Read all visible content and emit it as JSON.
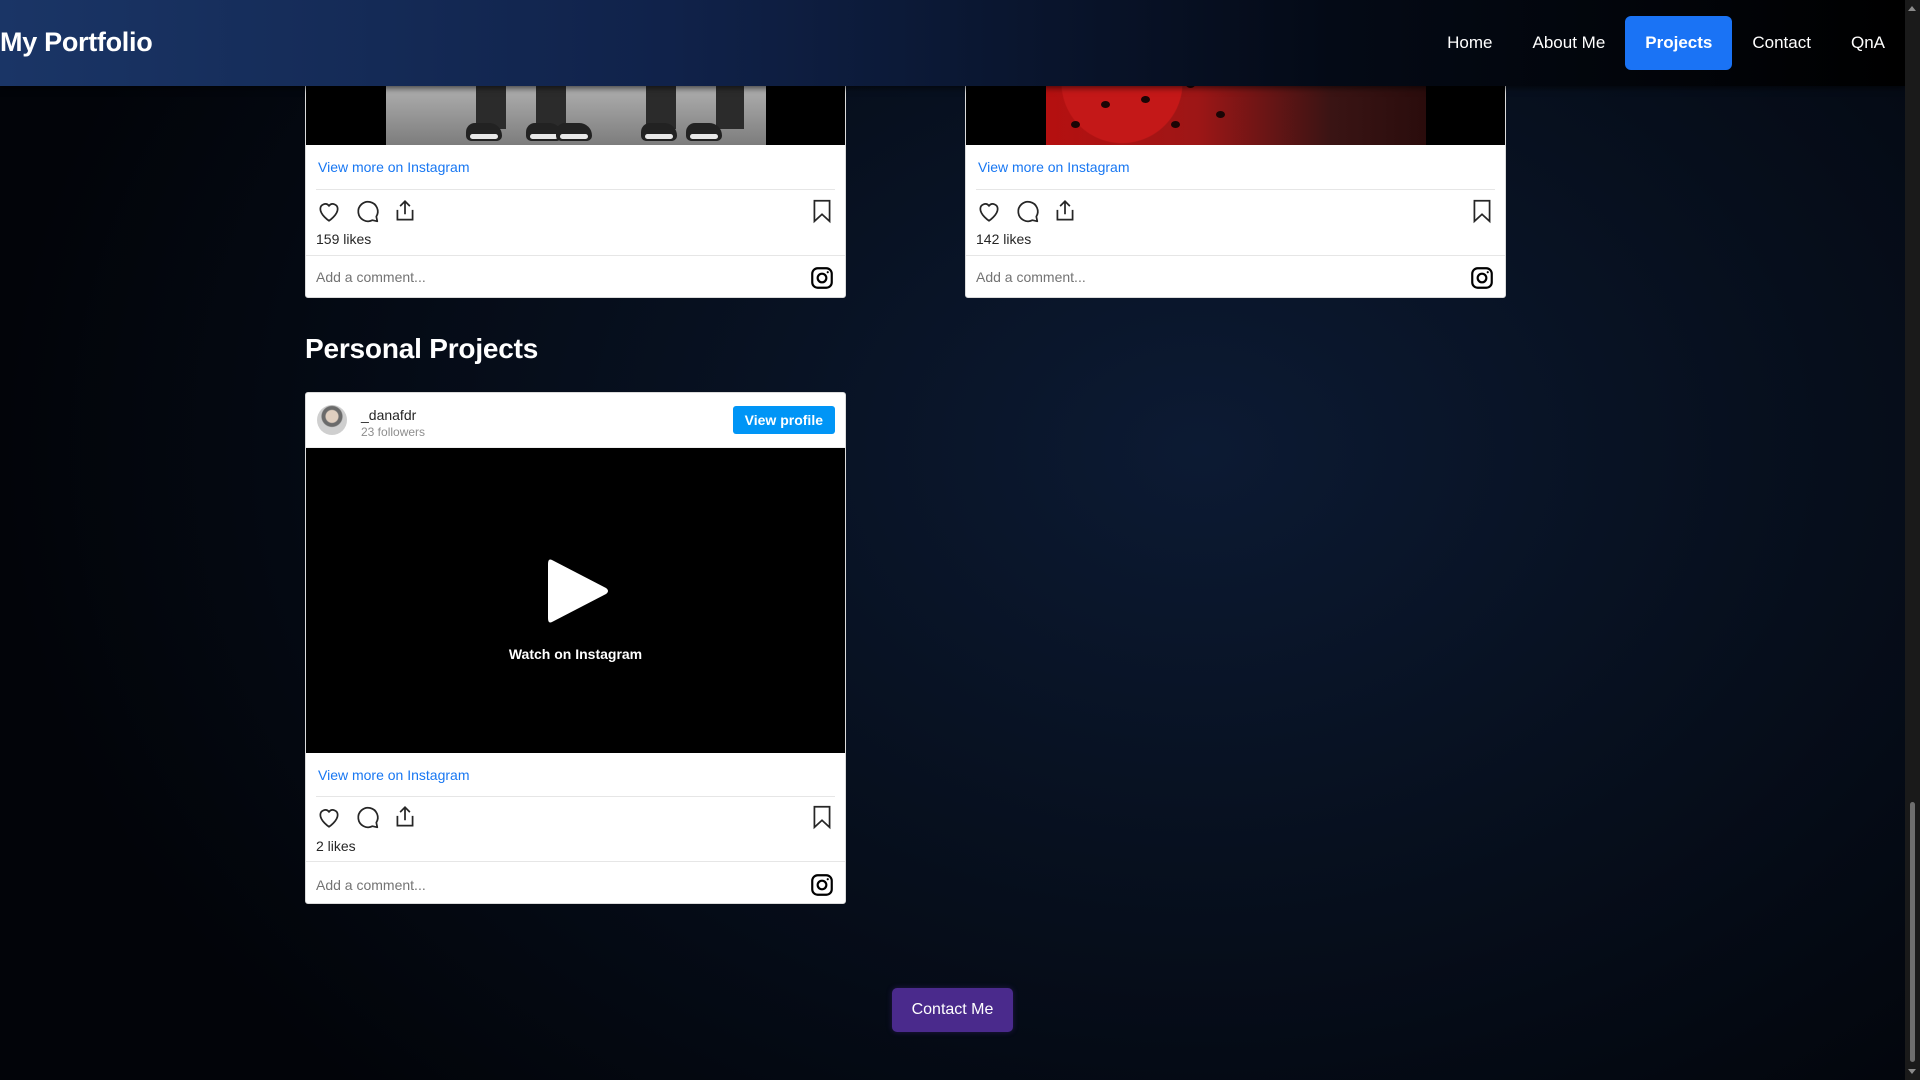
{
  "navbar": {
    "brand": "My Portfolio",
    "links": [
      {
        "label": "Home",
        "active": false
      },
      {
        "label": "About Me",
        "active": false
      },
      {
        "label": "Projects",
        "active": true
      },
      {
        "label": "Contact",
        "active": false
      },
      {
        "label": "QnA",
        "active": false
      }
    ],
    "active_color": "#1a73f5"
  },
  "top_cards": [
    {
      "view_more": "View more on Instagram",
      "likes": "159 likes",
      "comment_placeholder": "Add a comment..."
    },
    {
      "view_more": "View more on Instagram",
      "likes": "142 likes",
      "comment_placeholder": "Add a comment..."
    }
  ],
  "personal_projects": {
    "title": "Personal Projects",
    "card": {
      "username": "_danafdr",
      "followers": "23 followers",
      "view_profile": "View profile",
      "watch_label": "Watch on Instagram",
      "view_more": "View more on Instagram",
      "likes": "2 likes",
      "comment_placeholder": "Add a comment..."
    }
  },
  "contact_button": {
    "label": "Contact Me",
    "color": "#4a2a8c"
  },
  "icons": [
    "heart-icon",
    "comment-icon",
    "share-icon",
    "bookmark-icon",
    "instagram-icon",
    "play-icon"
  ]
}
